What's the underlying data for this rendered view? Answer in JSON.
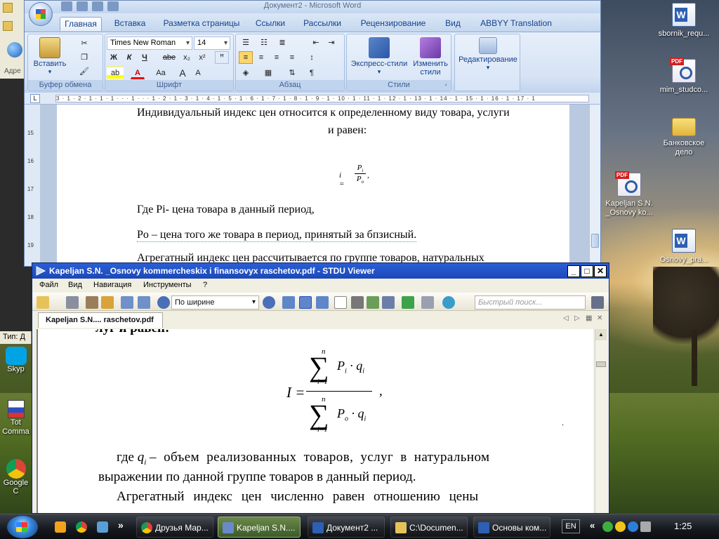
{
  "desktop": {
    "icons": [
      {
        "label": "sbornik_requ...",
        "type": "word"
      },
      {
        "label": "mim_studco...",
        "type": "pdf"
      },
      {
        "label": "Банковское дело",
        "type": "folder"
      },
      {
        "label": "Kapeljan S.N. _Osnovy ko...",
        "type": "pdf"
      },
      {
        "label": "Osnovy_pra...",
        "type": "word"
      }
    ],
    "left_labels": {
      "addr": "Адре",
      "tip": "Тип: Д",
      "skype": "Skyp",
      "total": "Tot Comma",
      "chrome": "Google C"
    }
  },
  "word": {
    "title": "Документ2 - Microsoft Word",
    "tabs": [
      "Главная",
      "Вставка",
      "Разметка страницы",
      "Ссылки",
      "Рассылки",
      "Рецензирование",
      "Вид",
      "ABBYY Translation"
    ],
    "active_tab": "Главная",
    "groups": {
      "clipboard": "Буфер обмена",
      "font": "Шрифт",
      "paragraph": "Абзац",
      "styles": "Стили",
      "editing": "Редактирование"
    },
    "paste_label": "Вставить",
    "font_name": "Times New Roman",
    "font_size": "14",
    "express_styles": "Экспресс-стили",
    "change_styles_1": "Изменить",
    "change_styles_2": "стили",
    "editing_label": "Редактирование",
    "font_buttons": {
      "bold": "Ж",
      "italic": "К",
      "underline": "Ч",
      "strike": "abe",
      "sub": "x₂",
      "sup": "x²",
      "case": "Aa",
      "grow": "A",
      "shrink": "A"
    },
    "ruler_text": "3 · 1 · 2 · 1 · 1 · 1 · · · 1 · · · 1 · 2 · 1 · 3 · 1 · 4 · 1 · 5 · 1 · 6 · 1 · 7 · 1 · 8 · 1 · 9 · 1 · 10 · 1 · 11 · 1 · 12 · 1 · 13 · 1 · 14 · 1 · 15 · 1 · 16 · 1 · 17 · 1",
    "vruler": [
      "15",
      "16",
      "17",
      "18",
      "19"
    ],
    "document": {
      "line1": "Индивидуальный индекс цен относится к определенному виду товара, услуги",
      "line2": "и равен:",
      "formula_lhs": "i =",
      "formula_num": "P",
      "formula_num_sub": "i",
      "formula_den": "P",
      "formula_den_sub": "o",
      "formula_tail": ",",
      "line3": "Где Pi- цена товара в данный период,",
      "line4": "Po – цена того же товара в период, принятый за бпзисный.",
      "line5": "Агрегатный индекс цен рассчитывается по группе товаров, натуральных"
    }
  },
  "stdu": {
    "title": "Kapeljan S.N. _Osnovy kommercheskix i finansovyx raschetov.pdf - STDU Viewer",
    "menu": [
      "Файл",
      "Вид",
      "Навигация",
      "Инструменты",
      "?"
    ],
    "zoom": "По ширине",
    "search_placeholder": "Быстрый поиск...",
    "doc_tab": "Kapeljan S.N.... raschetov.pdf",
    "pdf": {
      "top_fragment": "луг и равен:",
      "formula_I": "I =",
      "sum_top_n": "n",
      "sum_bot_i": "i=1",
      "num_term": "P",
      "num_term_sub": "i",
      "num_q": "· q",
      "num_q_sub": "i",
      "den_term": "P",
      "den_term_sub": "o",
      "den_q": "· q",
      "den_q_sub": "i",
      "formula_tail": ",",
      "p1_a": "где",
      "p1_q": "q",
      "p1_q_sub": "i",
      "p1_b": "– объем реализованных товаров, услуг в натуральном",
      "p2": "выражении по данной группе товаров в данный период.",
      "p3": "Агрегатный индекс цен численно равен отношению цены",
      "dot": "."
    }
  },
  "taskbar": {
    "tasks": [
      "Друзья Мар...",
      "Kapeljan S.N....",
      "Документ2 ...",
      "C:\\Documen...",
      "Основы ком..."
    ],
    "active_task": "Kapeljan S.N....",
    "lang": "EN",
    "clock": "1:25",
    "show_more": "»",
    "tray_more": "«"
  }
}
